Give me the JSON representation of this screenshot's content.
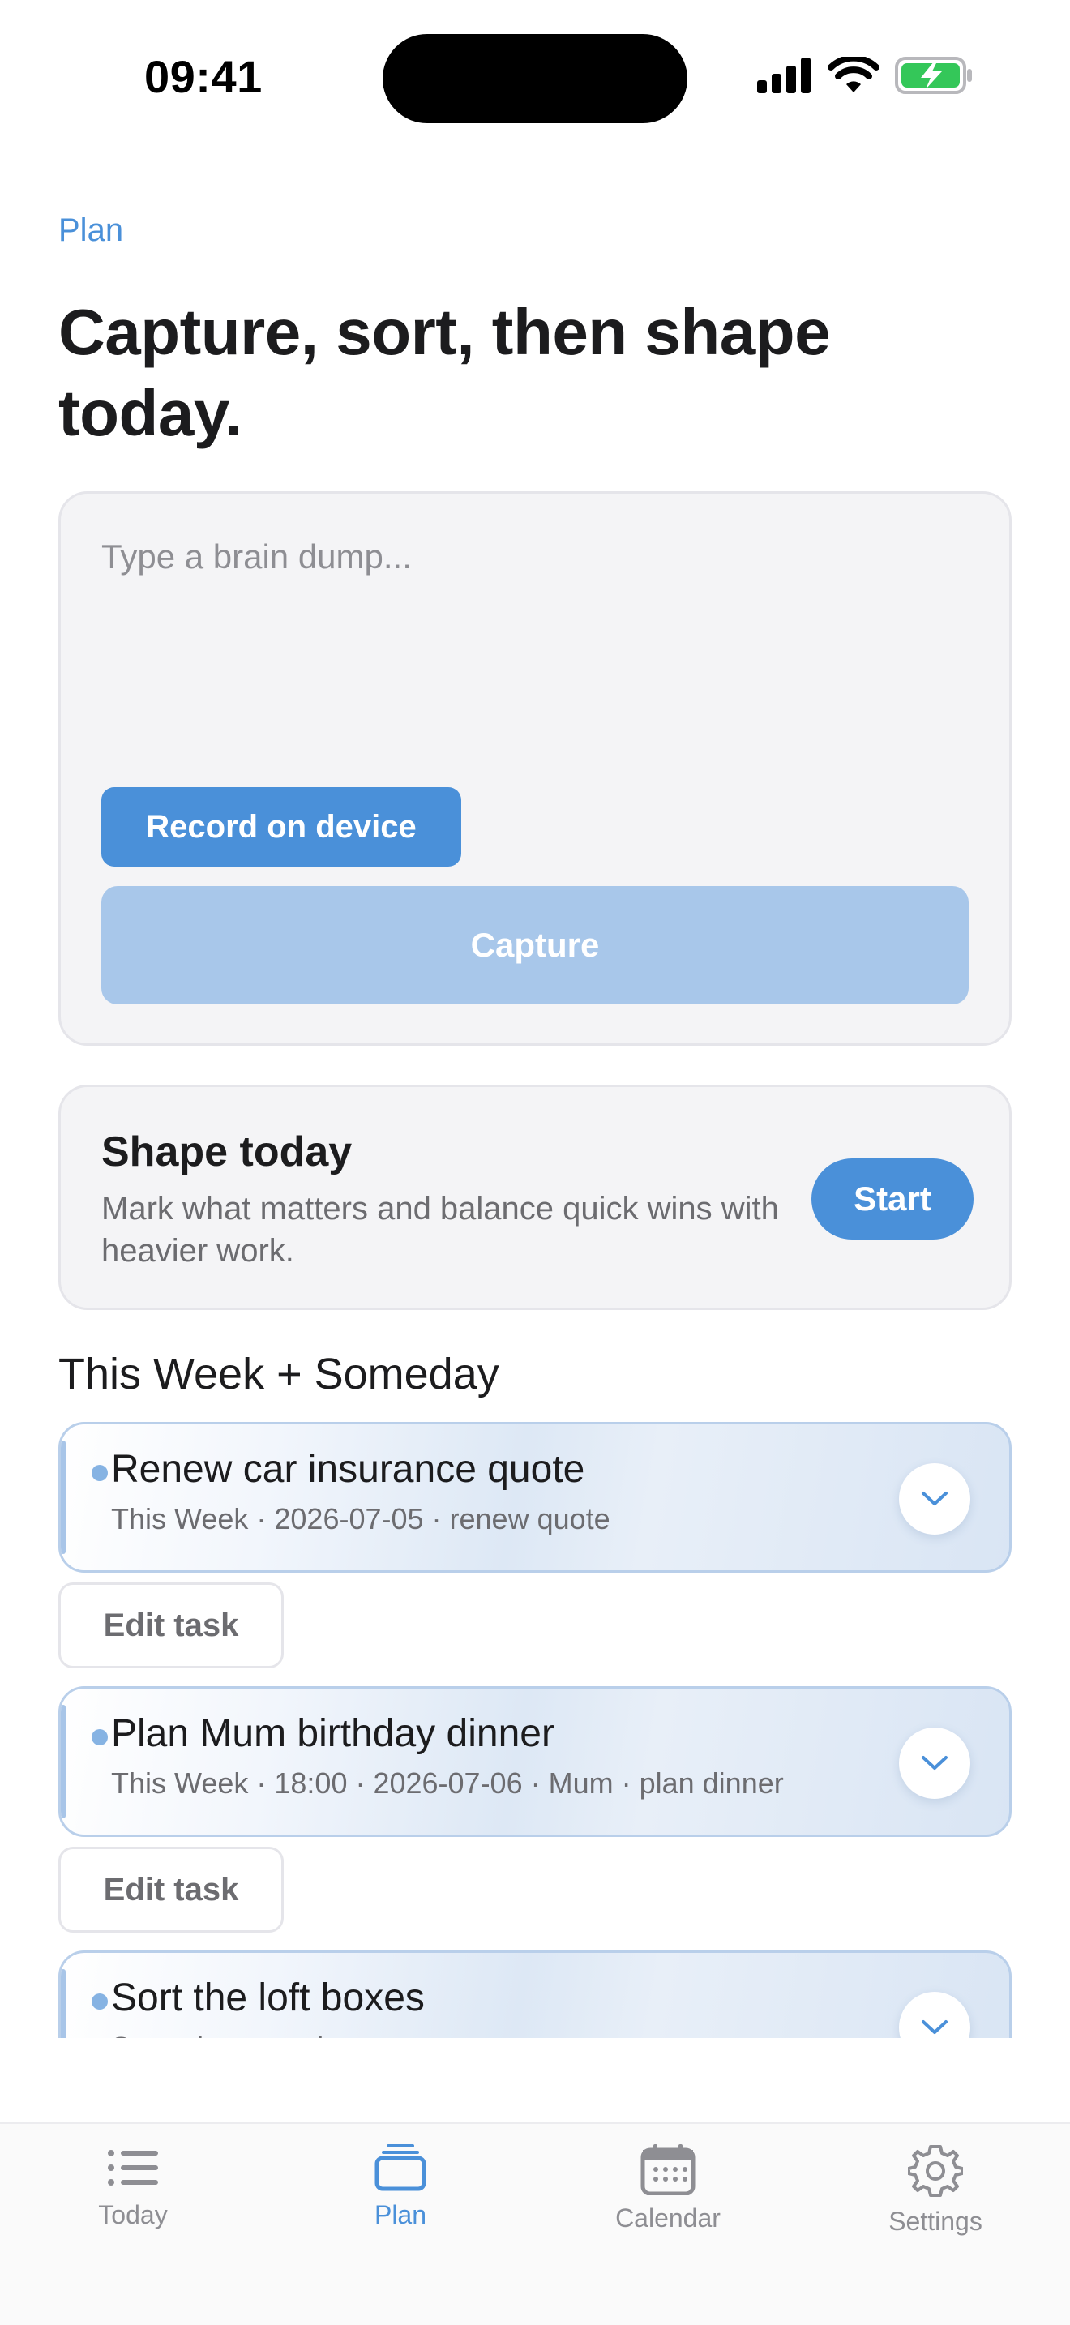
{
  "status_bar": {
    "time": "09:41",
    "icons": [
      "signal-icon",
      "wifi-icon",
      "battery-charging-icon"
    ]
  },
  "header": {
    "eyebrow": "Plan",
    "title": "Capture, sort, then shape today."
  },
  "capture": {
    "placeholder": "Type a brain dump...",
    "value": "",
    "record_label": "Record on device",
    "capture_label": "Capture"
  },
  "shape_today": {
    "title": "Shape today",
    "description": "Mark what matters and balance quick wins with heavier work.",
    "start_label": "Start"
  },
  "section": {
    "title": "This Week + Someday"
  },
  "tasks": [
    {
      "title": "Renew car insurance quote",
      "meta": "This Week · 2026-07-05 · renew quote",
      "edit_label": "Edit task"
    },
    {
      "title": "Plan Mum birthday dinner",
      "meta": "This Week · 18:00 · 2026-07-06 · Mum · plan dinner",
      "edit_label": "Edit task"
    },
    {
      "title": "Sort the loft boxes",
      "meta": "Someday · sort boxes"
    }
  ],
  "tab_bar": {
    "tabs": [
      {
        "label": "Today",
        "icon": "list-icon"
      },
      {
        "label": "Plan",
        "icon": "stack-icon",
        "active": true
      },
      {
        "label": "Calendar",
        "icon": "calendar-icon"
      },
      {
        "label": "Settings",
        "icon": "gear-icon"
      }
    ]
  },
  "colors": {
    "accent": "#4a90d9",
    "accent_disabled": "#a8c7ea",
    "card_bg": "#f4f4f6",
    "battery": "#34c759"
  }
}
